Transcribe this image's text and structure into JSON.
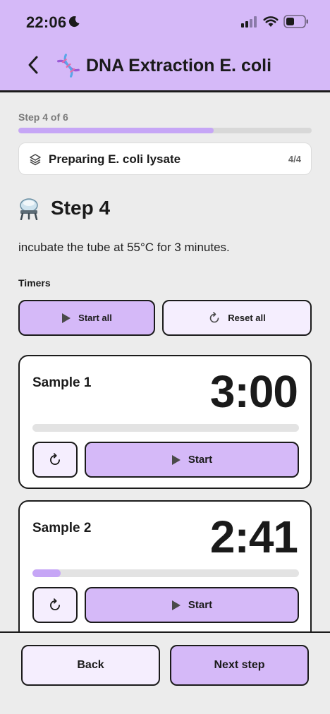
{
  "status": {
    "time": "22:06"
  },
  "header": {
    "title": "DNA Extraction E. coli",
    "emoji": "🧬"
  },
  "progress": {
    "label": "Step 4 of 6",
    "value": 0.667
  },
  "section": {
    "label": "Preparing E. coli lysate",
    "count": "4/4"
  },
  "step": {
    "emoji": "⚗️",
    "heading": "Step 4",
    "instruction": "incubate the tube at 55°C for 3 minutes."
  },
  "timers": {
    "label": "Timers",
    "start_all": "Start all",
    "reset_all": "Reset all",
    "items": [
      {
        "name": "Sample 1",
        "time": "3:00",
        "progress": 0.0,
        "start_label": "Start"
      },
      {
        "name": "Sample 2",
        "time": "2:41",
        "progress": 0.105,
        "start_label": "Start"
      }
    ]
  },
  "footer": {
    "back": "Back",
    "next": "Next step"
  },
  "colors": {
    "accent": "#d5b9f8",
    "accent_light": "#f5eefe",
    "progress_fill": "#c6a6f6"
  }
}
